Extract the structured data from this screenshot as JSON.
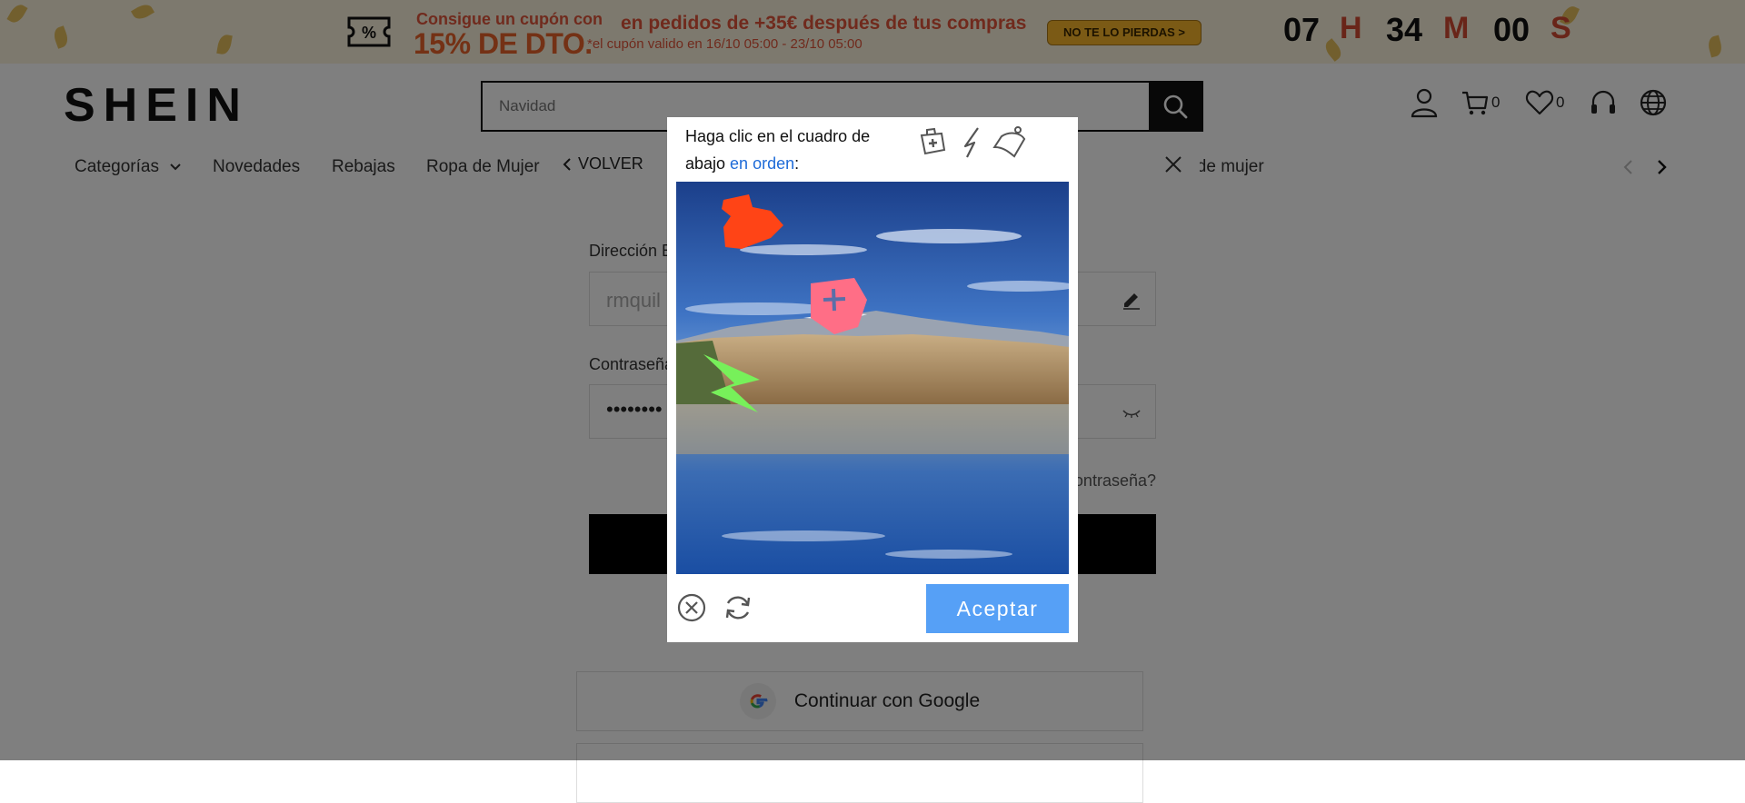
{
  "promo": {
    "coupon_line1": "Consigue un cupón con",
    "coupon_line2": "15% DE DTO.",
    "message": "en pedidos de +35€ después de tus compras",
    "validity": "*el cupón valido en 16/10 05:00 - 23/10 05:00",
    "cta_label": "NO TE LO PIERDAS >",
    "countdown": {
      "hours": "07",
      "hours_unit": "H",
      "minutes": "34",
      "minutes_unit": "M",
      "seconds": "00",
      "seconds_unit": "S"
    }
  },
  "header": {
    "logo": "SHEIN",
    "search_placeholder": "Navidad",
    "cart_count": "0",
    "wishlist_count": "0"
  },
  "nav": {
    "items": [
      "Categorías",
      "Novedades",
      "Rebajas",
      "Ropa de Mujer",
      "s de mujer"
    ]
  },
  "login": {
    "back_label": "VOLVER",
    "email_label": "Dirección E",
    "email_value": "rmquil",
    "password_label": "Contraseña",
    "password_value": "••••••••",
    "forgot_label": "ontraseña?"
  },
  "social": {
    "google_label": "Continuar con Google"
  },
  "captcha": {
    "instruction_prefix": "Haga clic en el cuadro de abajo ",
    "instruction_highlight": "en orden",
    "instruction_suffix": ":",
    "hint_icons": [
      "first-aid-kit-icon",
      "lightning-icon",
      "bell-icon"
    ],
    "accept_label": "Aceptar"
  }
}
